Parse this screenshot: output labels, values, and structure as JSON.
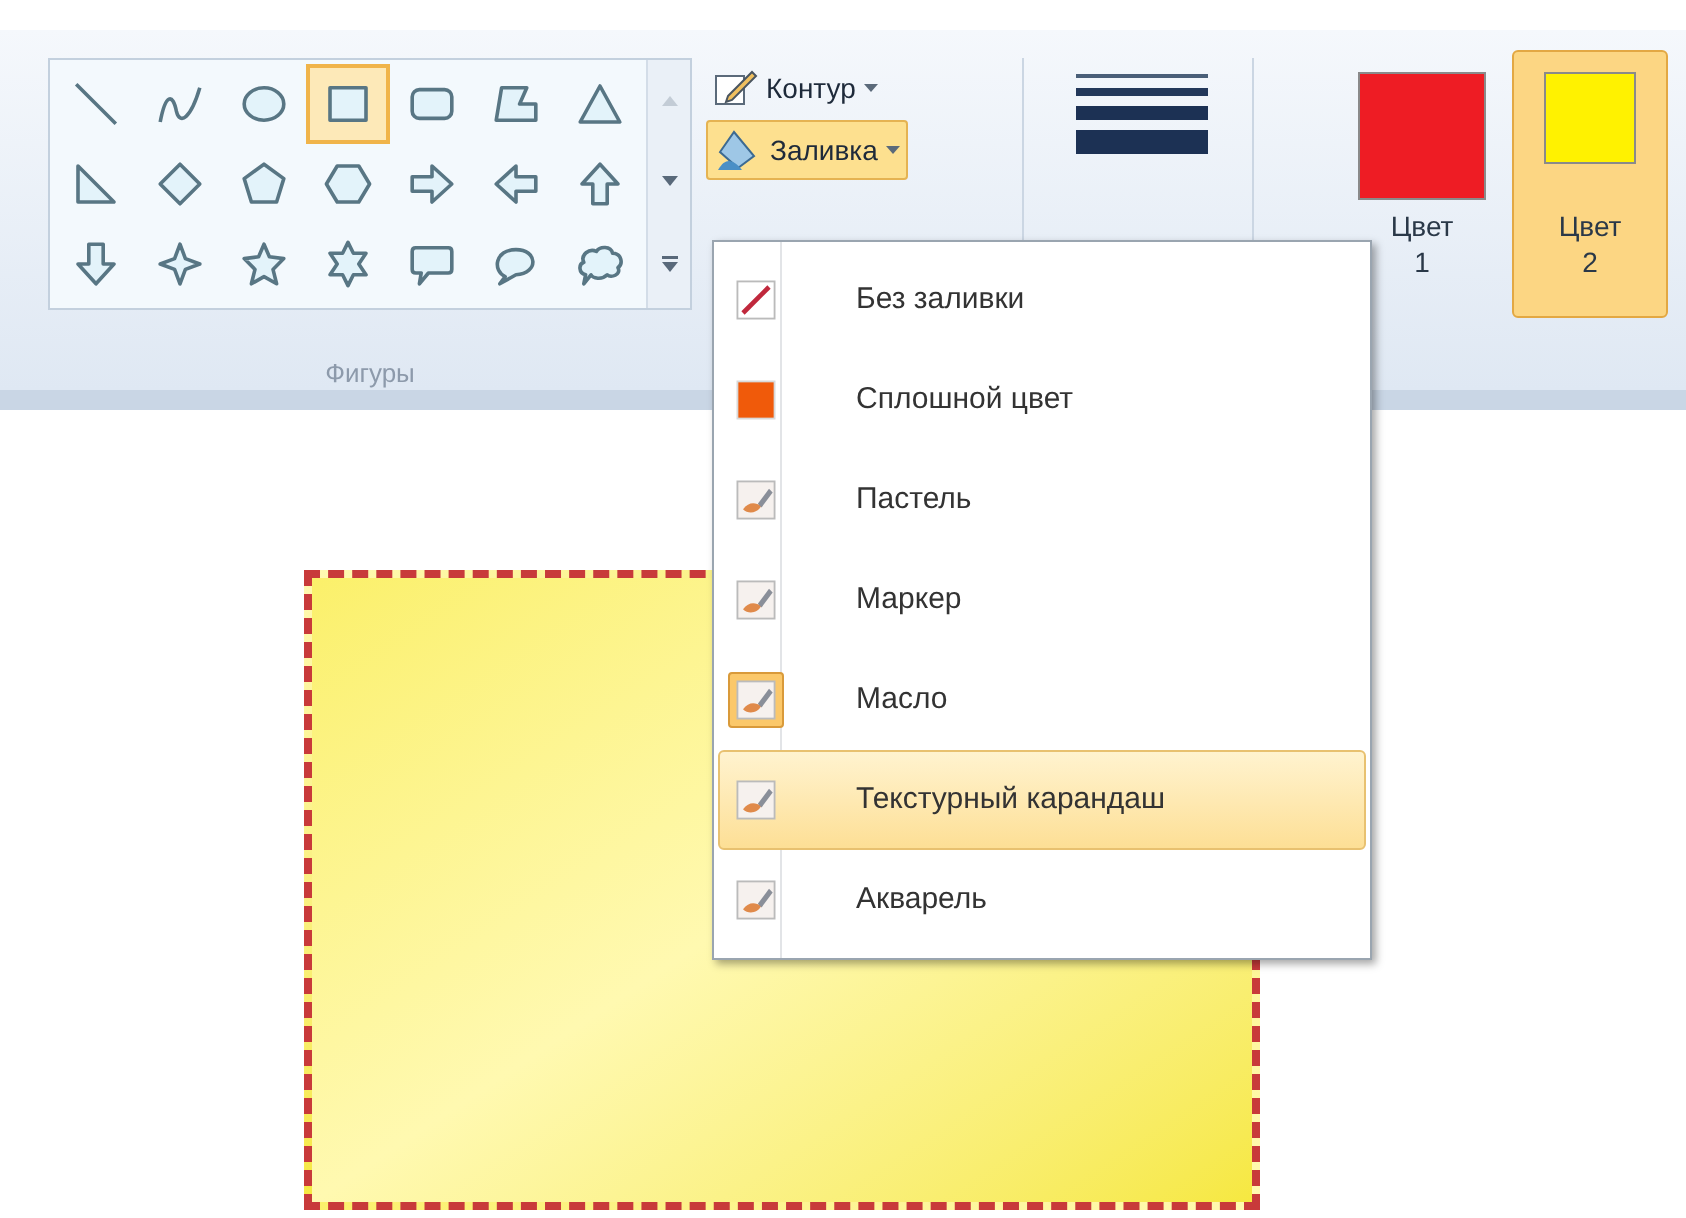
{
  "shapes": {
    "items": [
      {
        "kind": "line",
        "selected": false
      },
      {
        "kind": "curve",
        "selected": false
      },
      {
        "kind": "oval",
        "selected": false
      },
      {
        "kind": "rectangle",
        "selected": true
      },
      {
        "kind": "rounded-rectangle",
        "selected": false
      },
      {
        "kind": "polygon",
        "selected": false
      },
      {
        "kind": "triangle",
        "selected": false
      },
      {
        "kind": "right-triangle",
        "selected": false
      },
      {
        "kind": "diamond",
        "selected": false
      },
      {
        "kind": "pentagon",
        "selected": false
      },
      {
        "kind": "hexagon",
        "selected": false
      },
      {
        "kind": "arrow-right",
        "selected": false
      },
      {
        "kind": "arrow-left",
        "selected": false
      },
      {
        "kind": "arrow-up",
        "selected": false
      },
      {
        "kind": "arrow-down",
        "selected": false
      },
      {
        "kind": "star4",
        "selected": false
      },
      {
        "kind": "star5",
        "selected": false
      },
      {
        "kind": "star6",
        "selected": false
      },
      {
        "kind": "callout-rect",
        "selected": false
      },
      {
        "kind": "callout-oval",
        "selected": false
      },
      {
        "kind": "callout-cloud",
        "selected": false
      }
    ],
    "group_label": "Фигуры"
  },
  "outline_button": {
    "label": "Контур",
    "open": false
  },
  "fill_button": {
    "label": "Заливка",
    "open": true
  },
  "colors": [
    {
      "label_1": "Цвет",
      "label_2": "1",
      "color": "#ee1c24",
      "selected": false
    },
    {
      "label_1": "Цвет",
      "label_2": "2",
      "color": "#fff200",
      "selected": true
    }
  ],
  "fill_menu": [
    {
      "kind": "none",
      "label": "Без заливки",
      "checked": false,
      "highlighted": false
    },
    {
      "kind": "solid",
      "label": "Сплошной цвет",
      "checked": false,
      "highlighted": false
    },
    {
      "kind": "brush",
      "label": "Пастель",
      "checked": false,
      "highlighted": false
    },
    {
      "kind": "brush",
      "label": "Маркер",
      "checked": false,
      "highlighted": false
    },
    {
      "kind": "brush",
      "label": "Масло",
      "checked": true,
      "highlighted": false
    },
    {
      "kind": "brush",
      "label": "Текстурный карандаш",
      "checked": false,
      "highlighted": true
    },
    {
      "kind": "brush",
      "label": "Акварель",
      "checked": false,
      "highlighted": false
    }
  ]
}
